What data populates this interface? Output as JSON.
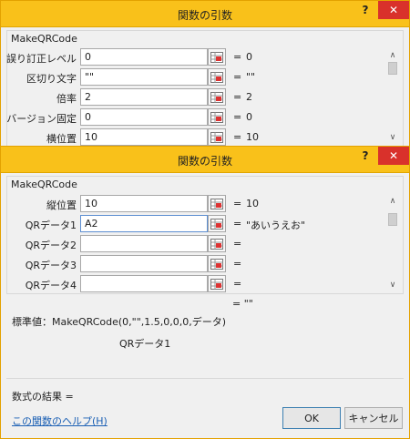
{
  "window_back": {
    "title": "関数の引数",
    "help_glyph": "?",
    "close_glyph": "✕",
    "group_title": "MakeQRCode",
    "args": [
      {
        "label": "誤り訂正レベル",
        "value": "0",
        "eq": "=",
        "result": "0"
      },
      {
        "label": "区切り文字",
        "value": "\"\"",
        "eq": "=",
        "result": "\"\""
      },
      {
        "label": "倍率",
        "value": "2",
        "eq": "=",
        "result": "2"
      },
      {
        "label": "バージョン固定",
        "value": "0",
        "eq": "=",
        "result": "0"
      },
      {
        "label": "横位置",
        "value": "10",
        "eq": "=",
        "result": "10"
      }
    ]
  },
  "window_front": {
    "title": "関数の引数",
    "help_glyph": "?",
    "close_glyph": "✕",
    "group_title": "MakeQRCode",
    "args": [
      {
        "label": "縦位置",
        "value": "10",
        "eq": "=",
        "result": "10"
      },
      {
        "label": "QRデータ1",
        "value": "A2",
        "eq": "=",
        "result": "\"あいうえお\""
      },
      {
        "label": "QRデータ2",
        "value": "",
        "eq": "=",
        "result": ""
      },
      {
        "label": "QRデータ3",
        "value": "",
        "eq": "=",
        "result": ""
      },
      {
        "label": "QRデータ4",
        "value": "",
        "eq": "=",
        "result": ""
      }
    ],
    "overall_result": "= \"\"",
    "standard_value": "標準値：MakeQRCode(0,\"\",1.5,0,0,0,データ)",
    "current_arg": "QRデータ1",
    "formula_result_label": "数式の結果 =",
    "help_link": "この関数のヘルプ(H)",
    "ok_label": "OK",
    "cancel_label": "キャンセル"
  },
  "colors": {
    "titlebar": "#f9c11a",
    "close": "#d9312b",
    "link": "#1a5fb4"
  }
}
